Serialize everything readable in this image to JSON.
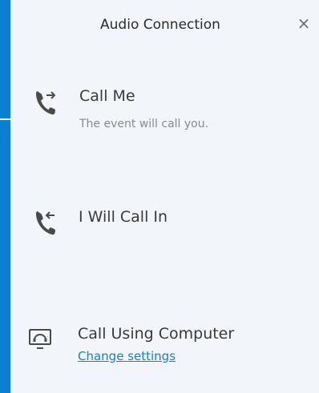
{
  "dialog": {
    "title": "Audio Connection",
    "close_glyph": "×"
  },
  "options": [
    {
      "label": "Call Me",
      "sub": "The event will call you.",
      "icon": "phone-outgoing-icon"
    },
    {
      "label": "I Will Call In",
      "icon": "phone-incoming-icon"
    },
    {
      "label": "Call Using Computer",
      "link": "Change settings",
      "icon": "computer-audio-icon"
    }
  ],
  "colors": {
    "accent": "#0a7fcf",
    "panel_bg": "#f2f6fa",
    "link": "#1a7fc9"
  }
}
